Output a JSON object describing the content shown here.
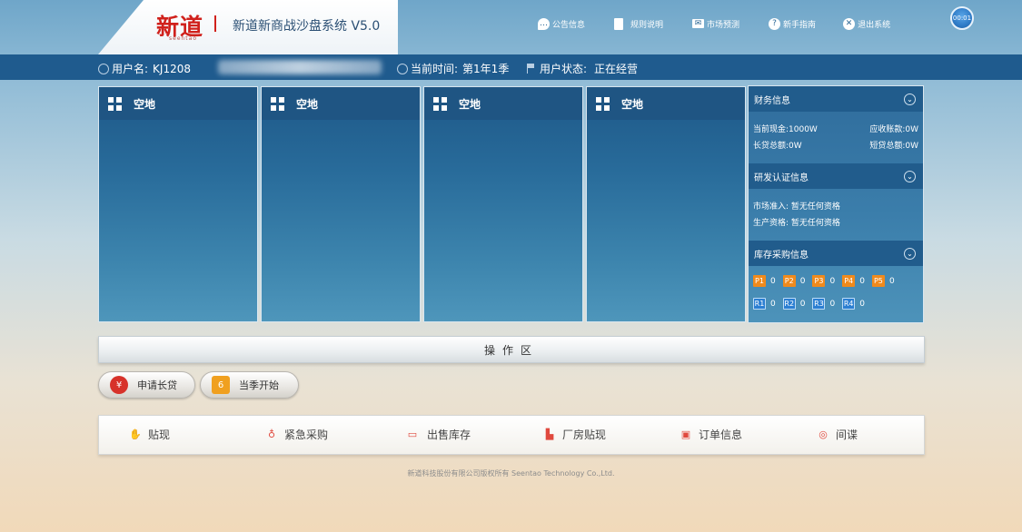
{
  "header": {
    "logo_text": "新道",
    "logo_sub": "seentao",
    "system_title": "新道新商战沙盘系统 V5.0",
    "nav": [
      {
        "label": "公告信息",
        "icon": "chat-bubble-icon"
      },
      {
        "label": "规则说明",
        "icon": "document-icon"
      },
      {
        "label": "市场预测",
        "icon": "mail-icon"
      },
      {
        "label": "新手指南",
        "icon": "help-icon"
      },
      {
        "label": "退出系统",
        "icon": "close-circle-icon"
      }
    ],
    "clock": "00:01"
  },
  "infobar": {
    "user_label": "用户名:",
    "user_value": "KJ1208",
    "time_label": "当前时间:",
    "time_value": "第1年1季",
    "status_label": "用户状态:",
    "status_value": "正在经营"
  },
  "factories": [
    {
      "title": "空地"
    },
    {
      "title": "空地"
    },
    {
      "title": "空地"
    },
    {
      "title": "空地"
    }
  ],
  "side": {
    "finance": {
      "title": "财务信息",
      "cash": "当前现金:1000W",
      "receivable": "应收账款:0W",
      "long_loan": "长贷总额:0W",
      "short_loan": "短贷总额:0W"
    },
    "rd": {
      "title": "研发认证信息",
      "market": "市场准入: 暂无任何资格",
      "product": "生产资格: 暂无任何资格"
    },
    "inventory": {
      "title": "库存采购信息",
      "products": [
        {
          "label": "P1",
          "count": "0"
        },
        {
          "label": "P2",
          "count": "0"
        },
        {
          "label": "P3",
          "count": "0"
        },
        {
          "label": "P4",
          "count": "0"
        },
        {
          "label": "P5",
          "count": "0"
        }
      ],
      "materials": [
        {
          "label": "R1",
          "count": "0"
        },
        {
          "label": "R2",
          "count": "0"
        },
        {
          "label": "R3",
          "count": "0"
        },
        {
          "label": "R4",
          "count": "0"
        }
      ]
    }
  },
  "operation": {
    "title": "操作区",
    "buttons": [
      {
        "label": "申请长贷",
        "icon": "loan-bag-icon"
      },
      {
        "label": "当季开始",
        "icon": "calendar-icon",
        "icon_text": "6"
      }
    ]
  },
  "actions": [
    {
      "label": "贴现",
      "icon": "hand-coin-icon"
    },
    {
      "label": "紧急采购",
      "icon": "lightbulb-icon"
    },
    {
      "label": "出售库存",
      "icon": "computer-icon"
    },
    {
      "label": "厂房贴现",
      "icon": "factory-icon"
    },
    {
      "label": "订单信息",
      "icon": "order-icon"
    },
    {
      "label": "间谍",
      "icon": "compass-icon"
    }
  ],
  "footer": "新道科技股份有限公司版权所有 Seentao Technology Co.,Ltd."
}
